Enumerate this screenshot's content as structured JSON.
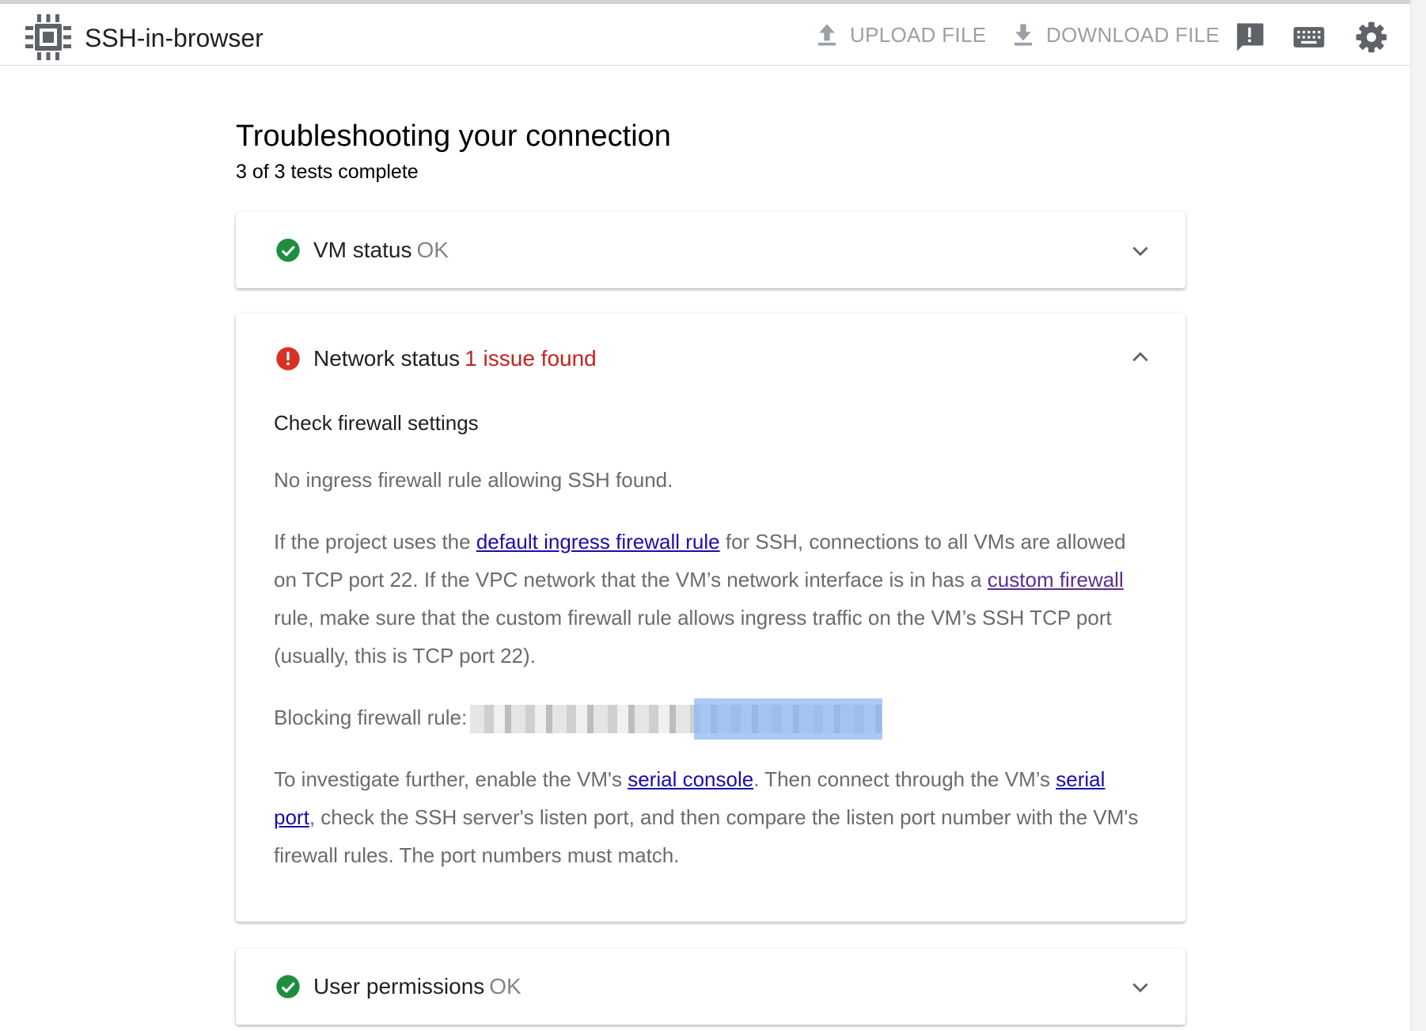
{
  "app": {
    "title": "SSH-in-browser"
  },
  "toolbar": {
    "upload_label": "UPLOAD FILE",
    "download_label": "DOWNLOAD FILE",
    "icons": [
      "feedback-icon",
      "keyboard-icon",
      "settings-icon"
    ]
  },
  "page": {
    "title": "Troubleshooting your connection",
    "progress": "3 of 3 tests complete"
  },
  "cards": {
    "vm": {
      "label": "VM status",
      "status": "OK",
      "expanded": false
    },
    "network": {
      "label": "Network status",
      "status": "1 issue found",
      "expanded": true,
      "section_title": "Check firewall settings",
      "p1": "No ingress firewall rule allowing SSH found.",
      "p2_a": "If the project uses the ",
      "p2_link1": "default ingress firewall rule",
      "p2_b": " for SSH, connections to all VMs are allowed on TCP port 22. If the VPC network that the VM’s network interface is in has a ",
      "p2_link2": "custom firewall",
      "p2_c": " rule, make sure that the custom firewall rule allows ingress traffic on the VM’s SSH TCP port (usually, this is TCP port 22).",
      "blocking_label": "Blocking firewall rule:",
      "p4_a": "To investigate further, enable the VM's ",
      "p4_link1": "serial console",
      "p4_b": ". Then connect through the VM’s ",
      "p4_link2": "serial port",
      "p4_c": ", check the SSH server's listen port, and then compare the listen port number with the VM's firewall rules. The port numbers must match."
    },
    "user": {
      "label": "User permissions",
      "status": "OK",
      "expanded": false
    }
  },
  "colors": {
    "ok_green": "#1e8e3e",
    "error_red": "#d93025",
    "link_blue": "#1a0dab",
    "link_visited": "#5c2d91",
    "muted_text": "#80868b"
  }
}
